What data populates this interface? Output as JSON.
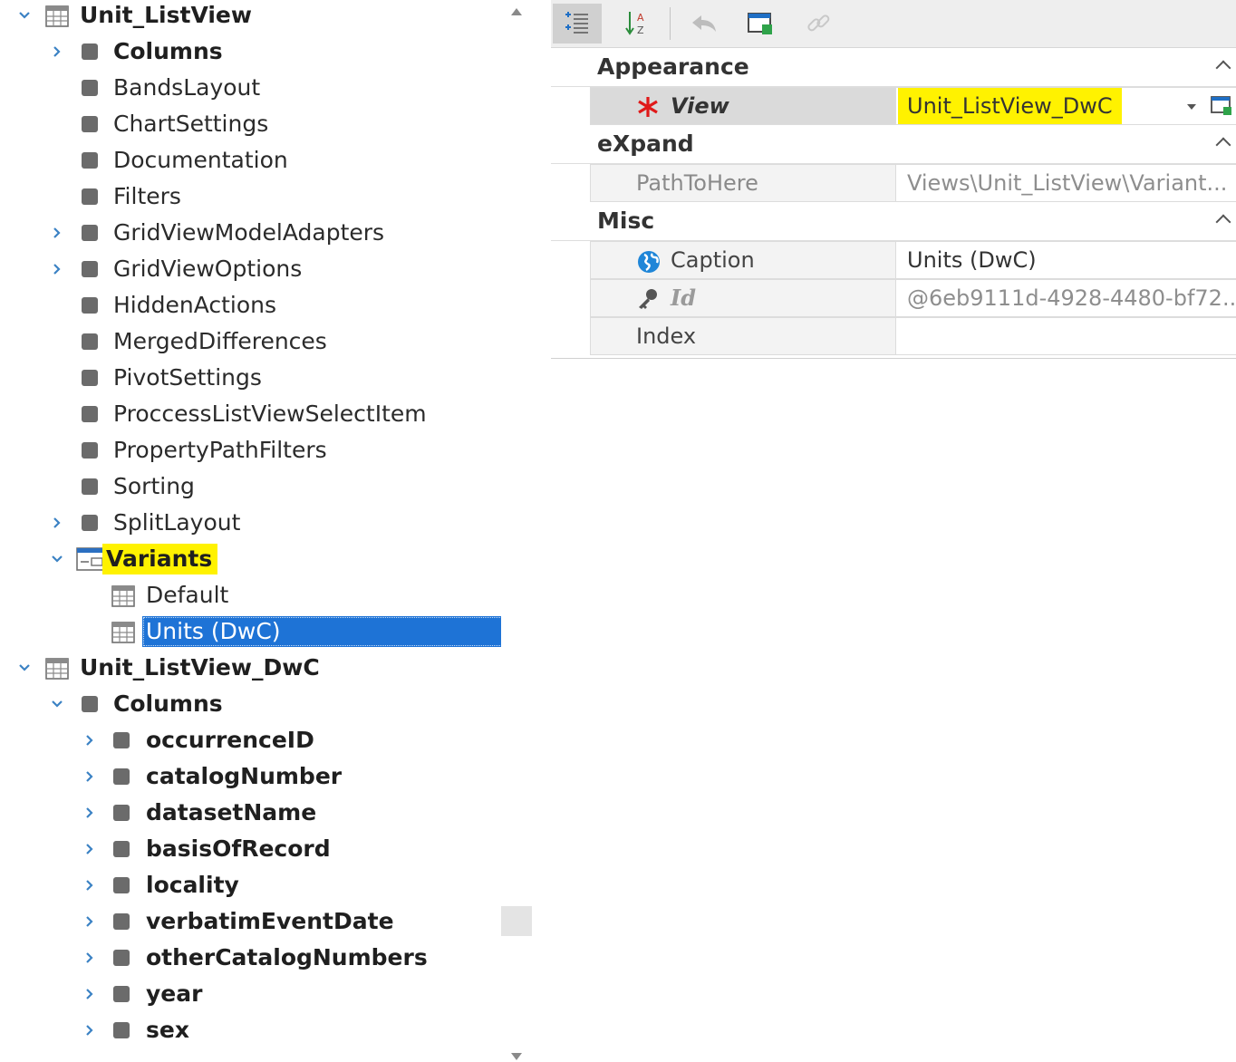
{
  "tree": {
    "items": [
      {
        "label": "Unit_ListView",
        "level": 0,
        "expander": "down",
        "icon": "listview-icon",
        "bold": true
      },
      {
        "label": "Columns",
        "level": 1,
        "expander": "right",
        "icon": "node-icon",
        "bold": true
      },
      {
        "label": "BandsLayout",
        "level": 1,
        "expander": "none",
        "icon": "node-icon"
      },
      {
        "label": "ChartSettings",
        "level": 1,
        "expander": "none",
        "icon": "node-icon"
      },
      {
        "label": "Documentation",
        "level": 1,
        "expander": "none",
        "icon": "node-icon"
      },
      {
        "label": "Filters",
        "level": 1,
        "expander": "none",
        "icon": "node-icon"
      },
      {
        "label": "GridViewModelAdapters",
        "level": 1,
        "expander": "right",
        "icon": "node-icon"
      },
      {
        "label": "GridViewOptions",
        "level": 1,
        "expander": "right",
        "icon": "node-icon"
      },
      {
        "label": "HiddenActions",
        "level": 1,
        "expander": "none",
        "icon": "node-icon"
      },
      {
        "label": "MergedDifferences",
        "level": 1,
        "expander": "none",
        "icon": "node-icon"
      },
      {
        "label": "PivotSettings",
        "level": 1,
        "expander": "none",
        "icon": "node-icon"
      },
      {
        "label": "ProccessListViewSelectItem",
        "level": 1,
        "expander": "none",
        "icon": "node-icon"
      },
      {
        "label": "PropertyPathFilters",
        "level": 1,
        "expander": "none",
        "icon": "node-icon"
      },
      {
        "label": "Sorting",
        "level": 1,
        "expander": "none",
        "icon": "node-icon"
      },
      {
        "label": "SplitLayout",
        "level": 1,
        "expander": "right",
        "icon": "node-icon"
      },
      {
        "label": "Variants",
        "level": 1,
        "expander": "down",
        "icon": "variants-icon",
        "bold": true,
        "highlight": true
      },
      {
        "label": "Default",
        "level": 2,
        "expander": "none",
        "icon": "listview-icon"
      },
      {
        "label": "Units (DwC)",
        "level": 2,
        "expander": "none",
        "icon": "listview-icon",
        "selected": true
      },
      {
        "label": "Unit_ListView_DwC",
        "level": 0,
        "expander": "down",
        "icon": "listview-icon",
        "bold": true
      },
      {
        "label": "Columns",
        "level": 1,
        "expander": "down",
        "icon": "node-icon",
        "bold": true
      },
      {
        "label": "occurrenceID",
        "level": 2,
        "expander": "right",
        "icon": "node-icon",
        "bold": true
      },
      {
        "label": "catalogNumber",
        "level": 2,
        "expander": "right",
        "icon": "node-icon",
        "bold": true
      },
      {
        "label": "datasetName",
        "level": 2,
        "expander": "right",
        "icon": "node-icon",
        "bold": true
      },
      {
        "label": "basisOfRecord",
        "level": 2,
        "expander": "right",
        "icon": "node-icon",
        "bold": true
      },
      {
        "label": "locality",
        "level": 2,
        "expander": "right",
        "icon": "node-icon",
        "bold": true
      },
      {
        "label": "verbatimEventDate",
        "level": 2,
        "expander": "right",
        "icon": "node-icon",
        "bold": true
      },
      {
        "label": "otherCatalogNumbers",
        "level": 2,
        "expander": "right",
        "icon": "node-icon",
        "bold": true
      },
      {
        "label": "year",
        "level": 2,
        "expander": "right",
        "icon": "node-icon",
        "bold": true
      },
      {
        "label": "sex",
        "level": 2,
        "expander": "right",
        "icon": "node-icon",
        "bold": true
      }
    ]
  },
  "toolbar": {
    "buttons": [
      {
        "name": "categorized-button",
        "icon": "categorized-icon",
        "active": true
      },
      {
        "name": "alphabetical-button",
        "icon": "sort-az-icon",
        "active": false
      },
      {
        "name": "undo-button",
        "icon": "undo-arrow-icon",
        "active": false
      },
      {
        "name": "window-button",
        "icon": "window-icon",
        "active": false
      },
      {
        "name": "link-button",
        "icon": "link-icon",
        "active": false
      }
    ]
  },
  "property_grid": {
    "categories": [
      {
        "label": "Appearance",
        "rows": [
          {
            "name": "View",
            "value": "Unit_ListView_DwC",
            "name_style": "required",
            "value_style": "highlight",
            "dropdown": true,
            "selected": true
          }
        ]
      },
      {
        "label": "eXpand",
        "rows": [
          {
            "name": "PathToHere",
            "value": "Views\\Unit_ListView\\Variant...",
            "name_style": "muted",
            "value_style": "muted"
          }
        ]
      },
      {
        "label": "Misc",
        "rows": [
          {
            "name": "Caption",
            "value": "Units (DwC)",
            "name_style": "localized",
            "value_style": "normal"
          },
          {
            "name": "Id",
            "value": "@6eb9111d-4928-4480-bf72...",
            "name_style": "key",
            "value_style": "muted"
          },
          {
            "name": "Index",
            "value": "",
            "name_style": "normal",
            "value_style": "normal"
          }
        ]
      }
    ]
  },
  "colors": {
    "selection": "#1e73d6",
    "highlight": "#fff200",
    "required_star": "#e01919",
    "globe": "#1f86d8"
  }
}
